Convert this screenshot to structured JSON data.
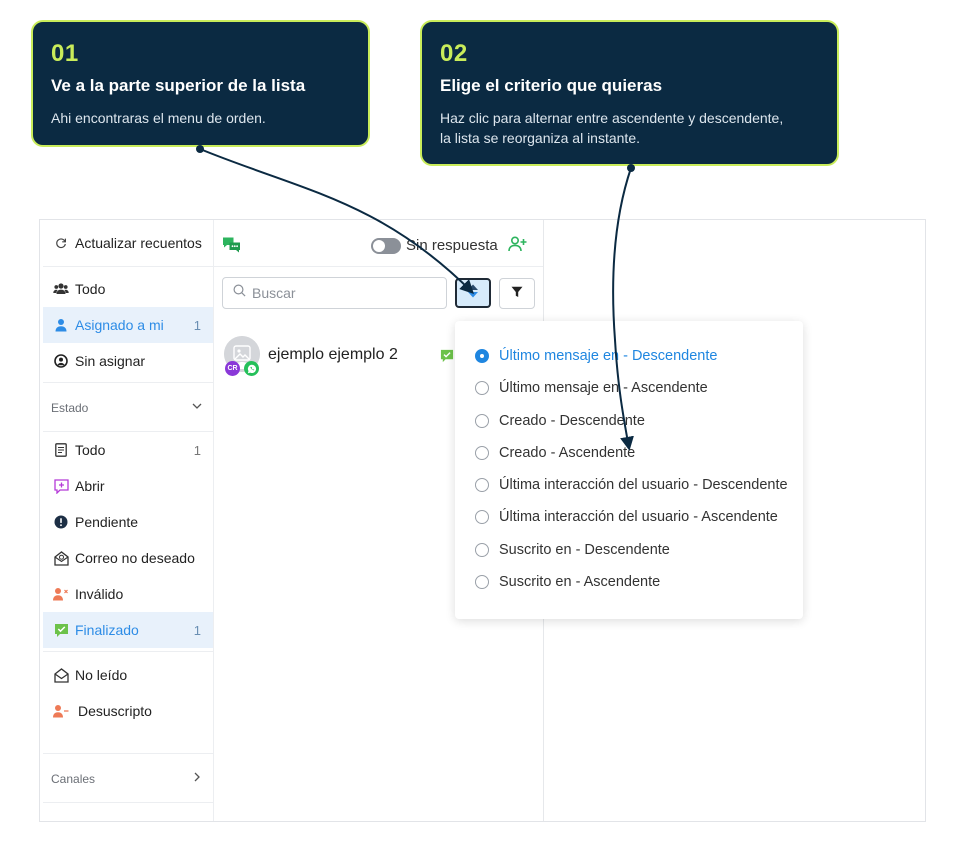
{
  "callouts": [
    {
      "number": "01",
      "title": "Ve a la parte superior de la lista",
      "body": "Ahi encontraras el menu de orden."
    },
    {
      "number": "02",
      "title": "Elige el criterio que quieras",
      "body_line1": "Haz clic para alternar entre ascendente y descendente,",
      "body_line2": "la lista se reorganiza al instante."
    }
  ],
  "sidebar": {
    "refresh_label": "Actualizar recuentos",
    "top_items": [
      {
        "label": "Todo",
        "count": ""
      },
      {
        "label": "Asignado a mi",
        "count": "1"
      },
      {
        "label": "Sin asignar",
        "count": ""
      }
    ],
    "estado_label": "Estado",
    "estado_items": [
      {
        "label": "Todo",
        "count": "1"
      },
      {
        "label": "Abrir",
        "count": ""
      },
      {
        "label": "Pendiente",
        "count": ""
      },
      {
        "label": "Correo no deseado",
        "count": ""
      },
      {
        "label": "Inválido",
        "count": ""
      },
      {
        "label": "Finalizado",
        "count": "1"
      }
    ],
    "extra_items": [
      {
        "label": "No leído"
      },
      {
        "label": "Desuscripto"
      }
    ],
    "canales_label": "Canales"
  },
  "list": {
    "unanswered_label": "Sin respuesta",
    "search_placeholder": "Buscar",
    "conversation": {
      "name": "ejemplo ejemplo 2",
      "initials": "CR"
    }
  },
  "sort_menu": {
    "selected_index": 0,
    "options": [
      "Último mensaje en - Descendente",
      "Último mensaje en - Ascendente",
      "Creado - Descendente",
      "Creado - Ascendente",
      "Última interacción del usuario - Descendente",
      "Última interacción del usuario - Ascendente",
      "Suscrito en - Descendente",
      "Suscrito en - Ascendente"
    ]
  },
  "colors": {
    "callout_bg": "#0b2a42",
    "callout_accent": "#c9ec5a",
    "active_blue": "#1f86e0",
    "active_row_bg": "#e8f1fb",
    "finalizado_green": "#6cc24a"
  },
  "icons": {
    "refresh": "refresh-icon",
    "users": "users-icon",
    "user": "user-icon",
    "user_circle": "user-circle-icon",
    "document": "document-icon",
    "open": "message-plus-icon",
    "pending": "exclamation-circle-icon",
    "spam": "spam-icon",
    "invalid": "user-x-icon",
    "done": "check-message-icon",
    "unread": "envelope-open-icon",
    "unsubscribed": "user-minus-icon",
    "chat": "chat-bubbles-icon",
    "add_user": "add-user-icon",
    "search": "search-icon",
    "sort": "sort-icon",
    "filter": "filter-icon",
    "whatsapp": "whatsapp-icon"
  }
}
